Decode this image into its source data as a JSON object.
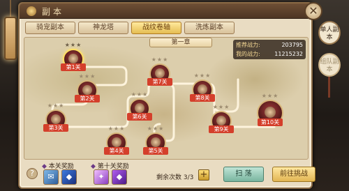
{
  "window": {
    "title": "副本",
    "close_glyph": "✕"
  },
  "tabs": [
    {
      "label": "骑宠副本",
      "active": false
    },
    {
      "label": "神龙塔",
      "active": false
    },
    {
      "label": "战纹卷轴",
      "active": true
    },
    {
      "label": "洗炼副本",
      "active": false
    }
  ],
  "chapter": "第一章",
  "power": {
    "recommend_label": "推荐战力:",
    "recommend_value": "203795",
    "mine_label": "我的战力:",
    "mine_value": "11215232"
  },
  "stages": [
    {
      "label": "第1关",
      "stars": "★★★",
      "current": true
    },
    {
      "label": "第2关",
      "stars": "★★★"
    },
    {
      "label": "第3关",
      "stars": "★★★"
    },
    {
      "label": "第4关",
      "stars": "★★★"
    },
    {
      "label": "第5关",
      "stars": "★★★"
    },
    {
      "label": "第6关",
      "stars": "★★★"
    },
    {
      "label": "第7关",
      "stars": "★★★"
    },
    {
      "label": "第8关",
      "stars": "★★★"
    },
    {
      "label": "第9关",
      "stars": "★★★"
    },
    {
      "label": "第10关",
      "stars": "★★★"
    }
  ],
  "rewards": {
    "this_title": "本关奖励",
    "tenth_title": "第十关奖励",
    "items": [
      "scroll",
      "blue-gem",
      "purple-card",
      "purple-gem"
    ]
  },
  "remaining": {
    "label": "剩余次数",
    "value": "3/3"
  },
  "buttons": {
    "help": "?",
    "plus": "+",
    "sweep": "扫 荡",
    "challenge": "前往挑战"
  },
  "side_tabs": {
    "single": "单人副本",
    "team": "组队副本"
  },
  "colors": {
    "accent": "#e5bd52",
    "stage_label": "#d43f2b",
    "power_text": "#f4d894"
  }
}
